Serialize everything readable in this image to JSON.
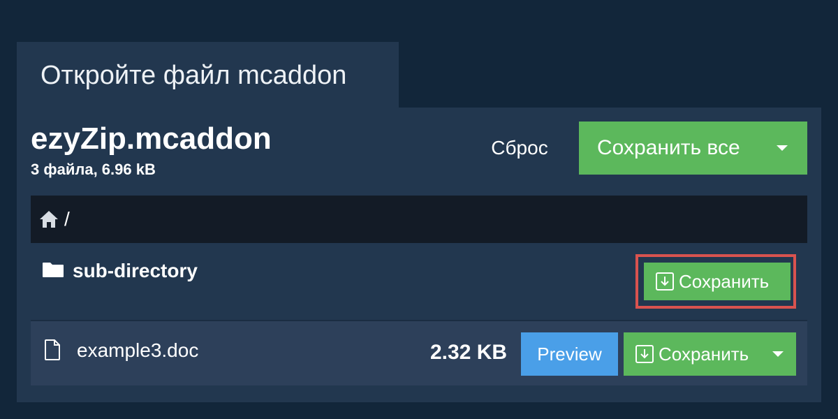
{
  "tab": {
    "title": "Откройте файл mcaddon"
  },
  "archive": {
    "name": "ezyZip.mcaddon",
    "info": "3 файла, 6.96 kB"
  },
  "toolbar": {
    "reset_label": "Сброс",
    "save_all_label": "Сохранить все"
  },
  "breadcrumb": {
    "separator": "/"
  },
  "items": [
    {
      "type": "directory",
      "name": "sub-directory",
      "save_label": "Сохранить"
    },
    {
      "type": "file",
      "name": "example3.doc",
      "size": "2.32 KB",
      "preview_label": "Preview",
      "save_label": "Сохранить"
    }
  ],
  "colors": {
    "background": "#12263a",
    "panel": "#22374f",
    "green": "#5cb85c",
    "blue": "#4a9fe8",
    "highlight": "#d9534f"
  }
}
